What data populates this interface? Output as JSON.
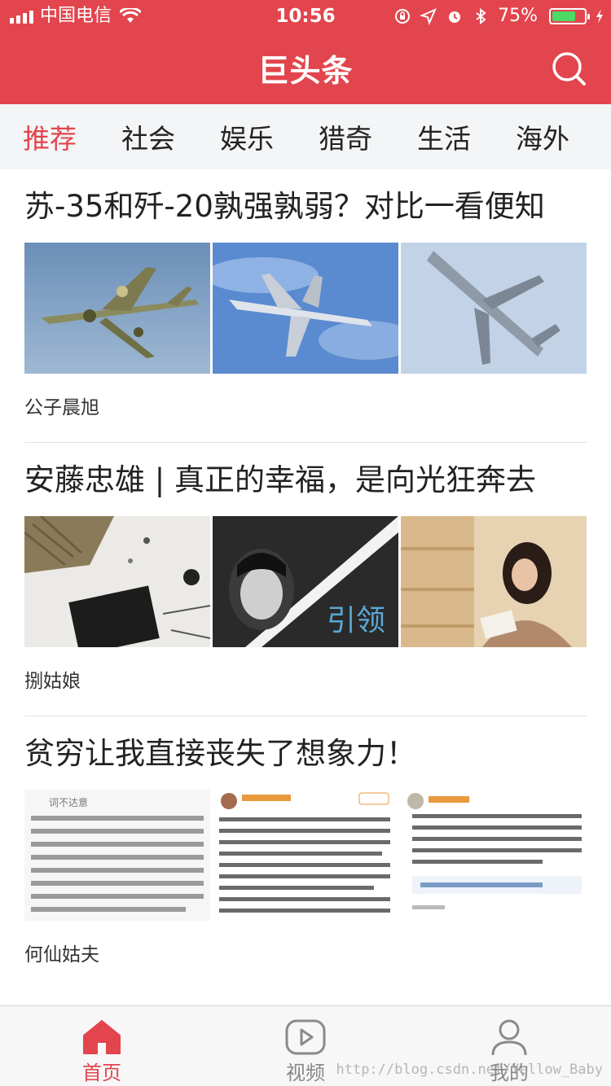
{
  "status_bar": {
    "carrier": "中国电信",
    "time": "10:56",
    "battery_percent": "75%",
    "battery_level": 0.75,
    "icons": [
      "signal-icon",
      "wifi-icon",
      "lock-rotation-icon",
      "location-icon",
      "alarm-icon",
      "bluetooth-icon",
      "battery-icon",
      "charging-icon"
    ]
  },
  "header": {
    "title": "巨头条",
    "search_icon": "search-icon",
    "bg_color": "#e2454d"
  },
  "tabs": [
    {
      "label": "推荐",
      "active": true
    },
    {
      "label": "社会",
      "active": false
    },
    {
      "label": "娱乐",
      "active": false
    },
    {
      "label": "猎奇",
      "active": false
    },
    {
      "label": "生活",
      "active": false
    },
    {
      "label": "海外",
      "active": false
    }
  ],
  "articles": [
    {
      "title": "苏-35和歼-20孰强孰弱？对比一看便知",
      "author": "公子晨旭",
      "images": [
        "camouflage-fighter-jet-photo",
        "fighter-jet-formation-photo",
        "fighter-jet-climbing-photo"
      ]
    },
    {
      "title": "安藤忠雄 | 真正的幸福，是向光狂奔去",
      "author": "捌姑娘",
      "images": [
        "flatlay-still-life-photo",
        "portrait-poster-photo",
        "woman-reading-photo"
      ],
      "image_caption": "引领"
    },
    {
      "title": "贫穷让我直接丧失了想象力！",
      "author": "何仙姑夫",
      "images": [
        "text-screenshot-1",
        "social-post-screenshot",
        "social-post-screenshot-2"
      ],
      "screenshot_heading": "词不达意"
    }
  ],
  "tabbar": [
    {
      "label": "首页",
      "icon": "home-icon",
      "active": true
    },
    {
      "label": "视频",
      "icon": "play-icon",
      "active": false
    },
    {
      "label": "我的",
      "icon": "user-icon",
      "active": false
    }
  ],
  "accent_color": "#e2454d",
  "watermark": "http://blog.csdn.net/Yellow_Baby"
}
